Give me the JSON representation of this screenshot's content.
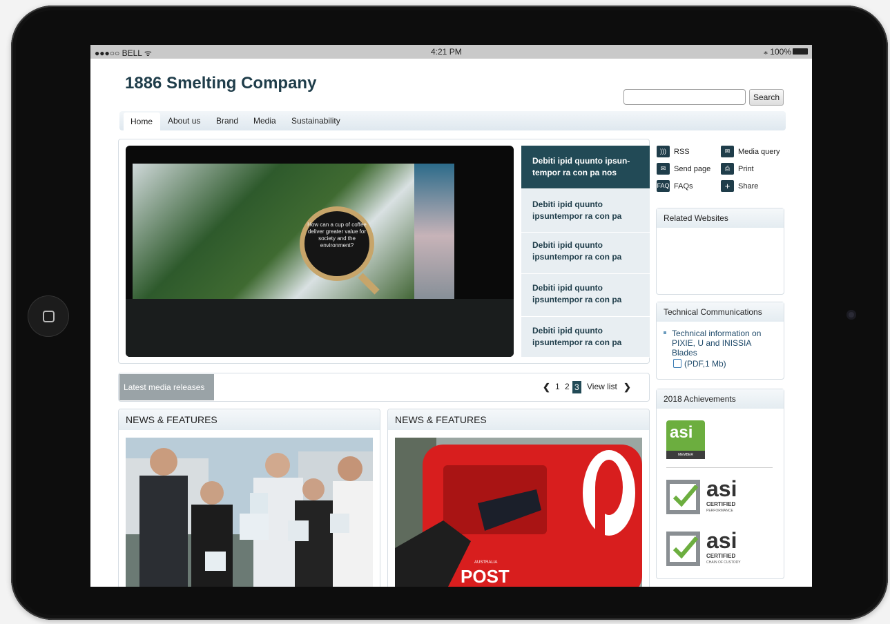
{
  "status": {
    "carrier": "●●●○○ BELL ᯤ",
    "time": "4:21 PM",
    "battery": "⁎ 100%"
  },
  "site": {
    "title": "1886 Smelting Company"
  },
  "search": {
    "placeholder": "",
    "button": "Search"
  },
  "nav": {
    "items": [
      "Home",
      "About us",
      "Brand",
      "Media",
      "Sustainability"
    ]
  },
  "hero": {
    "lens_text": "How can a cup of coffee deliver greater value for society and the environment?",
    "tiles": [
      "Debiti ipid quunto ipsun-tempor ra con pa nos",
      "Debiti ipid quunto ipsuntempor ra con pa",
      "Debiti ipid quunto ipsuntempor ra con pa",
      "Debiti ipid quunto ipsuntempor ra con pa",
      "Debiti ipid quunto ipsuntempor ra con pa"
    ]
  },
  "media_bar": {
    "label": "Latest media releases",
    "pages": [
      "1",
      "2",
      "3"
    ],
    "current": "3",
    "view_list": "View list",
    "prev": "❮",
    "next": "❯"
  },
  "news": [
    {
      "heading": "NEWS & FEATURES"
    },
    {
      "heading": "NEWS & FEATURES",
      "sign": "AUSTRALIA",
      "sign2": "POST"
    }
  ],
  "tools": {
    "rss": "RSS",
    "media_query": "Media query",
    "send_page": "Send page",
    "print": "Print",
    "faqs": "FAQs",
    "share": "Share",
    "faq_icon": "FAQ",
    "share_icon": "+"
  },
  "sidebar": {
    "related": {
      "title": "Related Websites"
    },
    "tech": {
      "title": "Technical Communications",
      "link": "Technical information on PIXIE, U and INISSIA Blades",
      "pdf": "(PDF,1 Mb)"
    },
    "achievements": {
      "title": "2018 Achievements",
      "badge1": "asi",
      "badge1_sub": "MEMBER",
      "badge2": "asi",
      "badge2_sub": "CERTIFIED",
      "badge2_sub2": "PERFORMANCE",
      "badge3": "asi",
      "badge3_sub": "CERTIFIED",
      "badge3_sub2": "CHAIN OF CUSTODY"
    }
  },
  "colors": {
    "brand_dark": "#224a56",
    "nav_bg": "#dfe8ef",
    "post_red": "#d81e1e"
  }
}
